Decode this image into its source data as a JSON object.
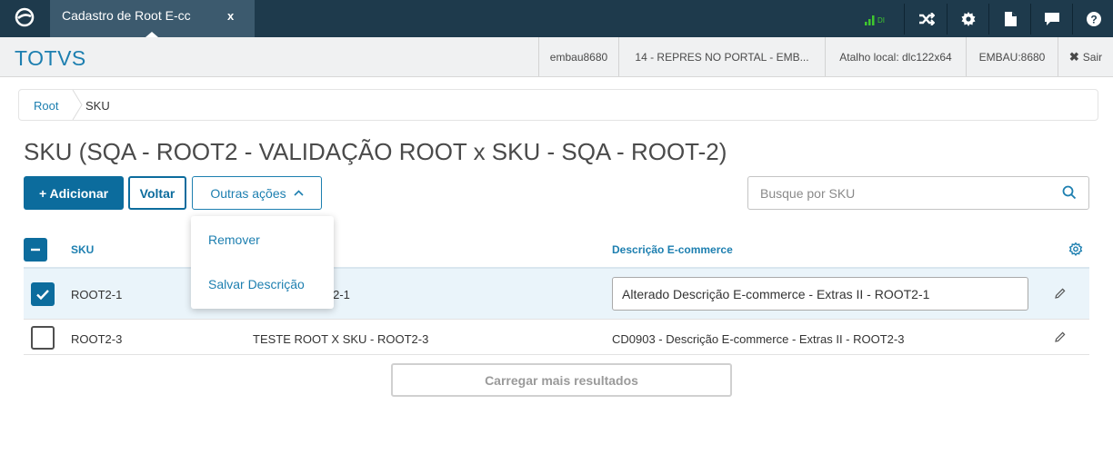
{
  "topbar": {
    "tab_label": "Cadastro de Root E-cc",
    "tab_close": "x",
    "signal_label": "DI"
  },
  "header": {
    "brand": "TOTVS",
    "user": "embau8680",
    "company": "14 - REPRES NO PORTAL - EMB...",
    "shortcut": "Atalho local: dlc122x64",
    "environment": "EMBAU:8680",
    "logout": "Sair"
  },
  "breadcrumb": {
    "root": "Root",
    "current": "SKU"
  },
  "page": {
    "title": "SKU (SQA - ROOT2 - VALIDAÇÃO ROOT x SKU - SQA - ROOT-2)"
  },
  "actions": {
    "add": "+ Adicionar",
    "back": "Voltar",
    "more": "Outras ações",
    "dropdown": [
      "Remover",
      "Salvar Descrição"
    ]
  },
  "search": {
    "placeholder": "Busque por SKU",
    "value": ""
  },
  "table": {
    "headers": {
      "sku": "SKU",
      "description": "Descrição E-commerce"
    },
    "rows": [
      {
        "sku": "ROOT2-1",
        "name": "X SKU - ROOT2-1",
        "description": "Alterado Descrição E-commerce - Extras II - ROOT2-1",
        "checked": true,
        "editing": true
      },
      {
        "sku": "ROOT2-3",
        "name": "TESTE ROOT X SKU - ROOT2-3",
        "description": "CD0903 - Descrição E-commerce - Extras II - ROOT2-3",
        "checked": false,
        "editing": false
      }
    ]
  },
  "load_more": "Carregar mais resultados",
  "colors": {
    "topbar": "#1e3a4c",
    "brand": "#1d7fb0",
    "primary": "#0c6c9d",
    "signal": "#3fc82e"
  }
}
